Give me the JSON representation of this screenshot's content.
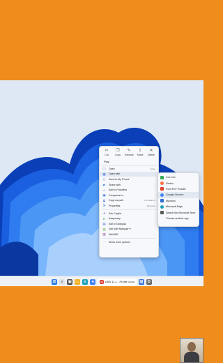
{
  "context_menu": {
    "quick_actions": [
      {
        "label": "Cut",
        "icon": "scissors-icon",
        "glyph": "✂"
      },
      {
        "label": "Copy",
        "icon": "copy-icon",
        "glyph": "❐"
      },
      {
        "label": "Rename",
        "icon": "rename-icon",
        "glyph": "✎"
      },
      {
        "label": "Share",
        "icon": "share-icon",
        "glyph": "⇪"
      },
      {
        "label": "Delete",
        "icon": "trash-icon",
        "glyph": "🗑"
      }
    ],
    "play_label": "Play",
    "items": [
      {
        "label": "Open",
        "shortcut": "Enter",
        "icon": "open-icon",
        "glyph": "▢"
      },
      {
        "label": "Open with",
        "shortcut": "›",
        "icon": "open-with-icon",
        "glyph": "▦"
      },
      {
        "label": "Send to My Phone",
        "shortcut": "",
        "icon": "phone-icon",
        "glyph": "▯"
      },
      {
        "label": "Share with",
        "shortcut": "›",
        "icon": "share-with-icon",
        "glyph": "⇄"
      },
      {
        "label": "Add to Favorites",
        "shortcut": "",
        "icon": "star-icon",
        "glyph": "☆"
      },
      {
        "label": "Compress to...",
        "shortcut": "›",
        "icon": "zip-icon",
        "glyph": "▣"
      },
      {
        "label": "Copy as path",
        "shortcut": "Ctrl+Shift+C",
        "icon": "path-icon",
        "glyph": "⧉"
      },
      {
        "label": "Properties",
        "shortcut": "Alt+Enter",
        "icon": "properties-icon",
        "glyph": "🔧"
      },
      {
        "label": "Ask Copilot",
        "shortcut": "",
        "icon": "copilot-icon",
        "glyph": "✦"
      },
      {
        "label": "Kaspersky",
        "shortcut": "›",
        "icon": "kaspersky-icon",
        "glyph": "K"
      },
      {
        "label": "Edit in Notepad",
        "shortcut": "",
        "icon": "notepad-icon",
        "glyph": "▤"
      },
      {
        "label": "Edit with Notepad++",
        "shortcut": "",
        "icon": "notepadpp-icon",
        "glyph": "▤"
      },
      {
        "label": "WinRAR",
        "shortcut": "›",
        "icon": "winrar-icon",
        "glyph": "▥"
      },
      {
        "label": "Show more options",
        "shortcut": "",
        "icon": "more-options-icon",
        "glyph": "⋯"
      }
    ]
  },
  "open_with_submenu": {
    "apps": [
      {
        "label": "Cốc Cốc",
        "color": "#3aa757"
      },
      {
        "label": "Firefox",
        "color": "#ff7139"
      },
      {
        "label": "Foxit PDF Reader",
        "color": "#e0442a"
      },
      {
        "label": "Google Chrome",
        "color": "#4285f4"
      },
      {
        "label": "Maxthon",
        "color": "#2f6fd6"
      },
      {
        "label": "Microsoft Edge",
        "color": "#1fa0b8"
      },
      {
        "label": "Search the Microsoft Store",
        "color": "#5a5a5a"
      }
    ],
    "choose_label": "Choose another app"
  },
  "taskbar": {
    "open_app_label": "DBS 11.1 - Profile 4.md",
    "icons": [
      "windows-start-icon",
      "search-icon",
      "task-view-icon",
      "folder-icon",
      "edge-icon",
      "chrome-icon",
      "store-icon"
    ]
  },
  "colors": {
    "frame_orange": "#ee8c1c",
    "wallpaper_blue": "#1a5fe0",
    "menu_bg": "#f6f8fb",
    "highlight": "#e3e9f2"
  }
}
